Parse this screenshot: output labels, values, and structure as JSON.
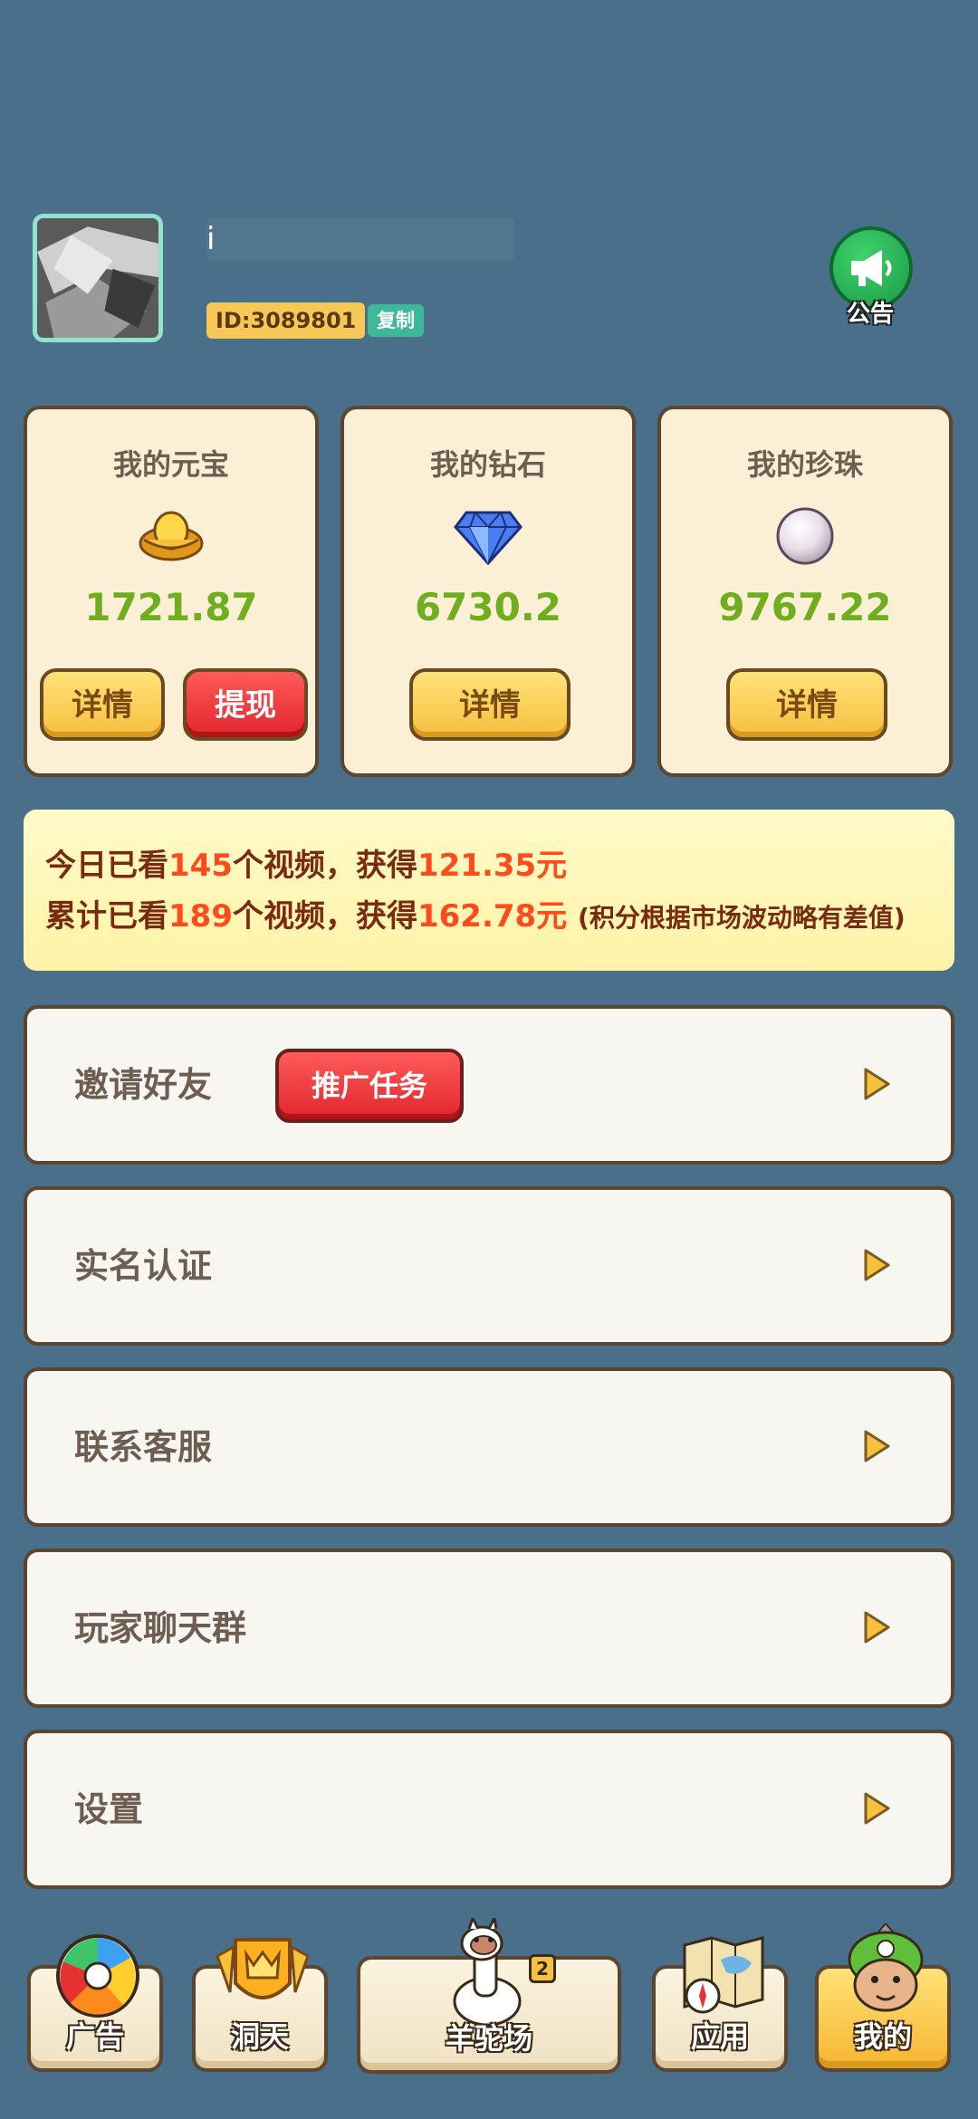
{
  "profile": {
    "nickname": "i",
    "id_label": "ID:3089801",
    "copy_label": "复制",
    "notice_label": "公告"
  },
  "cards": [
    {
      "title": "我的元宝",
      "icon": "gold-ingot-icon",
      "amount": "1721.87",
      "details_label": "详情",
      "withdraw_label": "提现"
    },
    {
      "title": "我的钻石",
      "icon": "diamond-icon",
      "amount": "6730.2",
      "details_label": "详情"
    },
    {
      "title": "我的珍珠",
      "icon": "pearl-icon",
      "amount": "9767.22",
      "details_label": "详情"
    }
  ],
  "stats": {
    "today_prefix": "今日已看",
    "today_count": "145",
    "today_mid": "个视频，获得",
    "today_amount": "121.35元",
    "total_prefix": "累计已看",
    "total_count": "189",
    "total_mid": "个视频，获得",
    "total_amount": "162.78元",
    "total_note": "(积分根据市场波动略有差值)"
  },
  "menu": {
    "invite": "邀请好友",
    "promo_task": "推广任务",
    "real_name": "实名认证",
    "support": "联系客服",
    "chat_group": "玩家聊天群",
    "settings": "设置"
  },
  "nav": {
    "ads": "广告",
    "dongtian": "洞天",
    "alpaca": "羊驼场",
    "alpaca_badge": "2",
    "apps": "应用",
    "mine": "我的",
    "active": "mine"
  },
  "colors": {
    "background": "#4a6f8a",
    "card": "#fbf0d6",
    "amount_green": "#6fae1f",
    "highlight_orange": "#ff4a1c",
    "button_yellow": "#f6bf3e",
    "button_red": "#e0262c"
  }
}
